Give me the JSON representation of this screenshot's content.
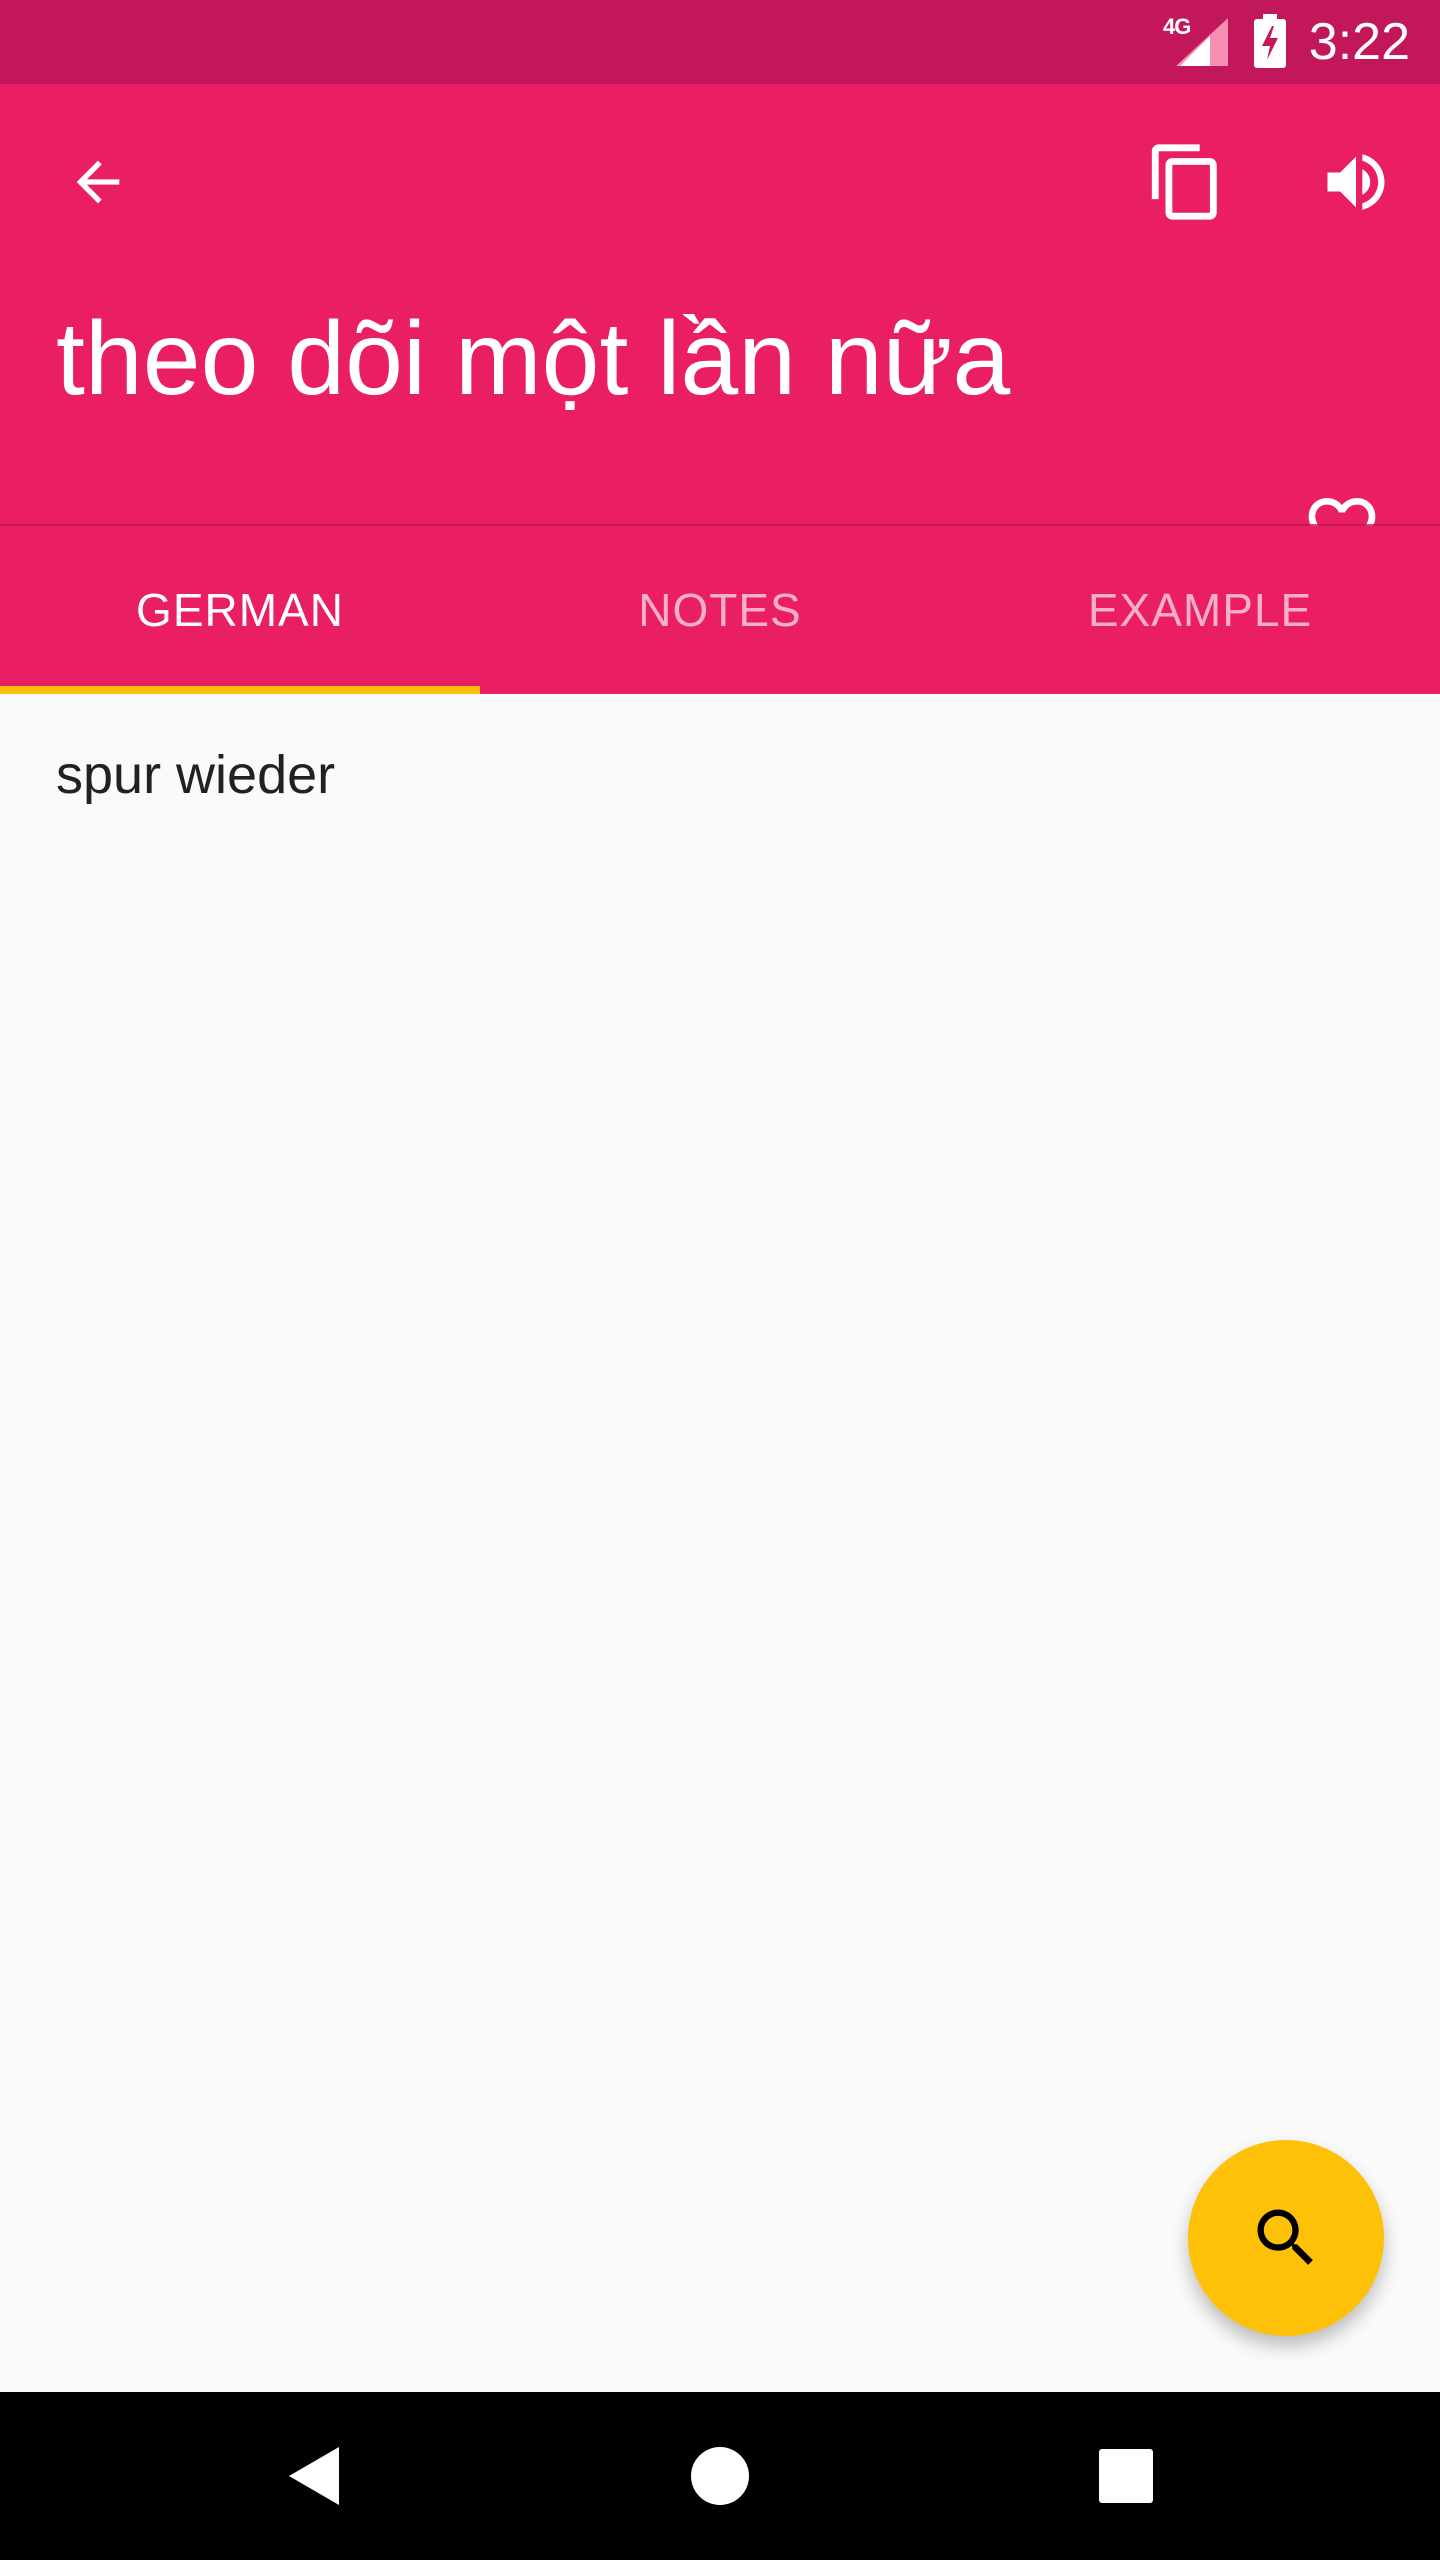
{
  "status_bar": {
    "network": "4G",
    "time": "3:22"
  },
  "app_bar": {
    "title": "theo dõi một lần nữa",
    "icons": {
      "back": "arrow-left-icon",
      "copy": "copy-icon",
      "sound": "volume-icon",
      "favorite": "heart-outline-icon"
    }
  },
  "tabs": [
    {
      "label": "GERMAN",
      "active": true
    },
    {
      "label": "NOTES",
      "active": false
    },
    {
      "label": "EXAMPLE",
      "active": false
    }
  ],
  "content": {
    "translation": "spur wieder"
  },
  "fab": {
    "icon": "search-icon"
  },
  "colors": {
    "primary": "#e91e63",
    "primary_dark": "#c2185b",
    "accent": "#ffc107",
    "background": "#fafafa",
    "text": "#212121"
  }
}
